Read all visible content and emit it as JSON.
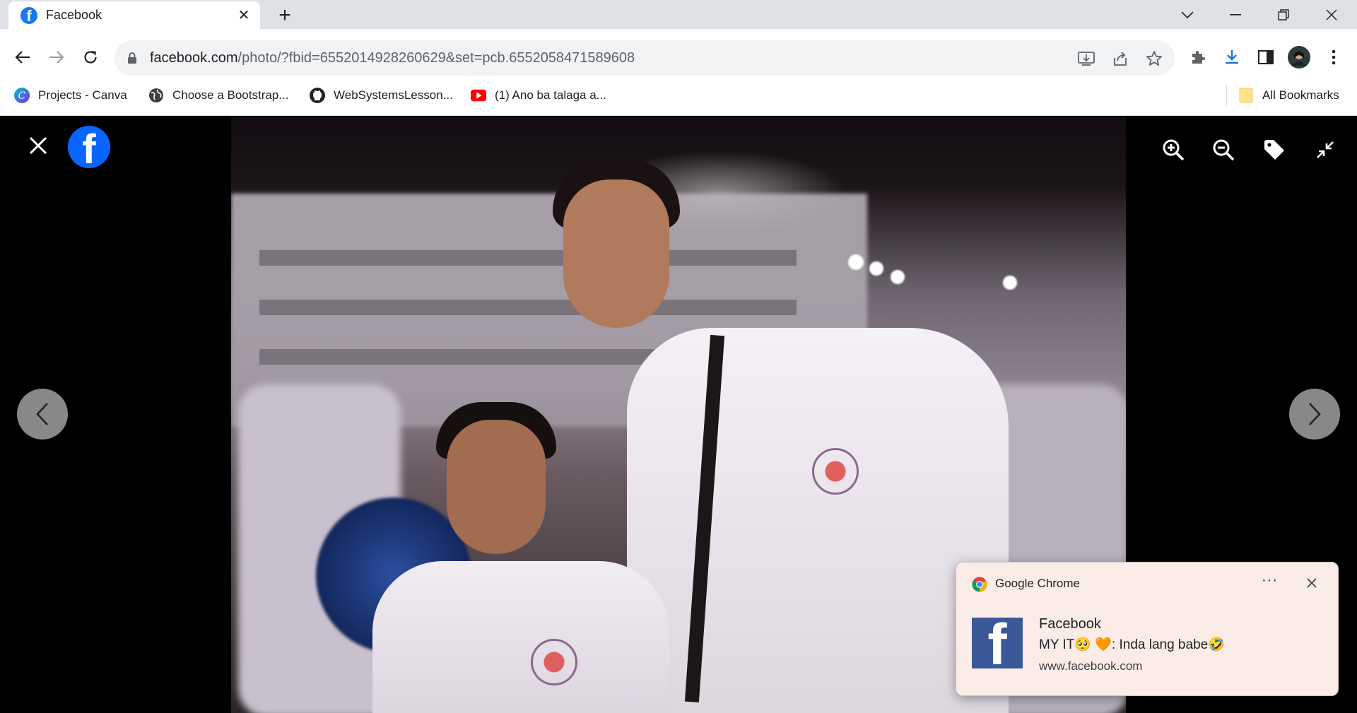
{
  "browser": {
    "tab_title": "Facebook",
    "tab_favicon_letter": "f",
    "tab_close": "✕",
    "new_tab": "+",
    "url_host": "facebook.com",
    "url_path": "/photo/?fbid=6552014928260629&set=pcb.6552058471589608",
    "bookmarks": [
      {
        "label": "Projects - Canva",
        "icon": "canva-icon"
      },
      {
        "label": "Choose a Bootstrap...",
        "icon": "globe-icon"
      },
      {
        "label": "WebSystemsLesson...",
        "icon": "github-icon"
      },
      {
        "label": "(1) Ano ba talaga a...",
        "icon": "youtube-icon"
      }
    ],
    "all_bookmarks": "All Bookmarks"
  },
  "viewer": {
    "logo_letter": "f",
    "tools": [
      "zoom-in-icon",
      "zoom-out-icon",
      "tag-icon",
      "exit-fullscreen-icon"
    ]
  },
  "notification": {
    "source": "Google Chrome",
    "more": "···",
    "title": "Facebook",
    "body": "MY IT🥺 🧡: Inda lang babe🤣",
    "site": "www.facebook.com",
    "icon_letter": "f"
  },
  "colors": {
    "facebook_blue": "#0866ff",
    "chrome_tabstrip": "#dee1e6",
    "notification_bg": "#fbece8"
  }
}
